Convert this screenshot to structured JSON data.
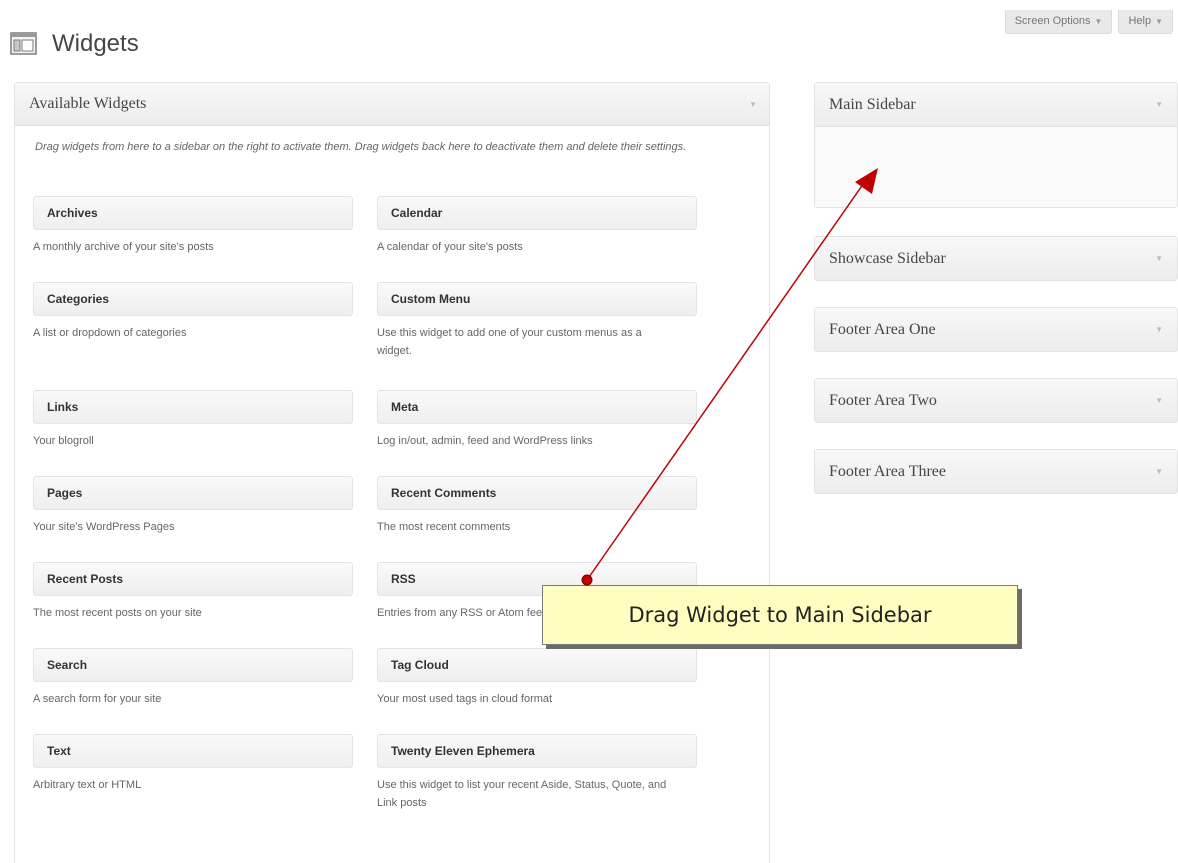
{
  "header": {
    "title": "Widgets",
    "icon": "widgets-icon"
  },
  "top_buttons": {
    "screen_options": "Screen Options",
    "help": "Help"
  },
  "available": {
    "title": "Available Widgets",
    "description": "Drag widgets from here to a sidebar on the right to activate them. Drag widgets back here to deactivate them and delete their settings.",
    "widgets": [
      {
        "title": "Archives",
        "desc": "A monthly archive of your site's posts"
      },
      {
        "title": "Calendar",
        "desc": "A calendar of your site's posts"
      },
      {
        "title": "Categories",
        "desc": "A list or dropdown of categories"
      },
      {
        "title": "Custom Menu",
        "desc": "Use this widget to add one of your custom menus as a widget."
      },
      {
        "title": "Links",
        "desc": "Your blogroll"
      },
      {
        "title": "Meta",
        "desc": "Log in/out, admin, feed and WordPress links"
      },
      {
        "title": "Pages",
        "desc": "Your site's WordPress Pages"
      },
      {
        "title": "Recent Comments",
        "desc": "The most recent comments"
      },
      {
        "title": "Recent Posts",
        "desc": "The most recent posts on your site"
      },
      {
        "title": "RSS",
        "desc": "Entries from any RSS or Atom feed"
      },
      {
        "title": "Search",
        "desc": "A search form for your site"
      },
      {
        "title": "Tag Cloud",
        "desc": "Your most used tags in cloud format"
      },
      {
        "title": "Text",
        "desc": "Arbitrary text or HTML"
      },
      {
        "title": "Twenty Eleven Ephemera",
        "desc": "Use this widget to list your recent Aside, Status, Quote, and Link posts"
      }
    ]
  },
  "sidebars": [
    {
      "title": "Main Sidebar"
    },
    {
      "title": "Showcase Sidebar"
    },
    {
      "title": "Footer Area One"
    },
    {
      "title": "Footer Area Two"
    },
    {
      "title": "Footer Area Three"
    }
  ],
  "callout": {
    "text": "Drag Widget to Main Sidebar"
  },
  "colors": {
    "arrow": "#c00000",
    "callout_bg": "#fffdc0"
  }
}
